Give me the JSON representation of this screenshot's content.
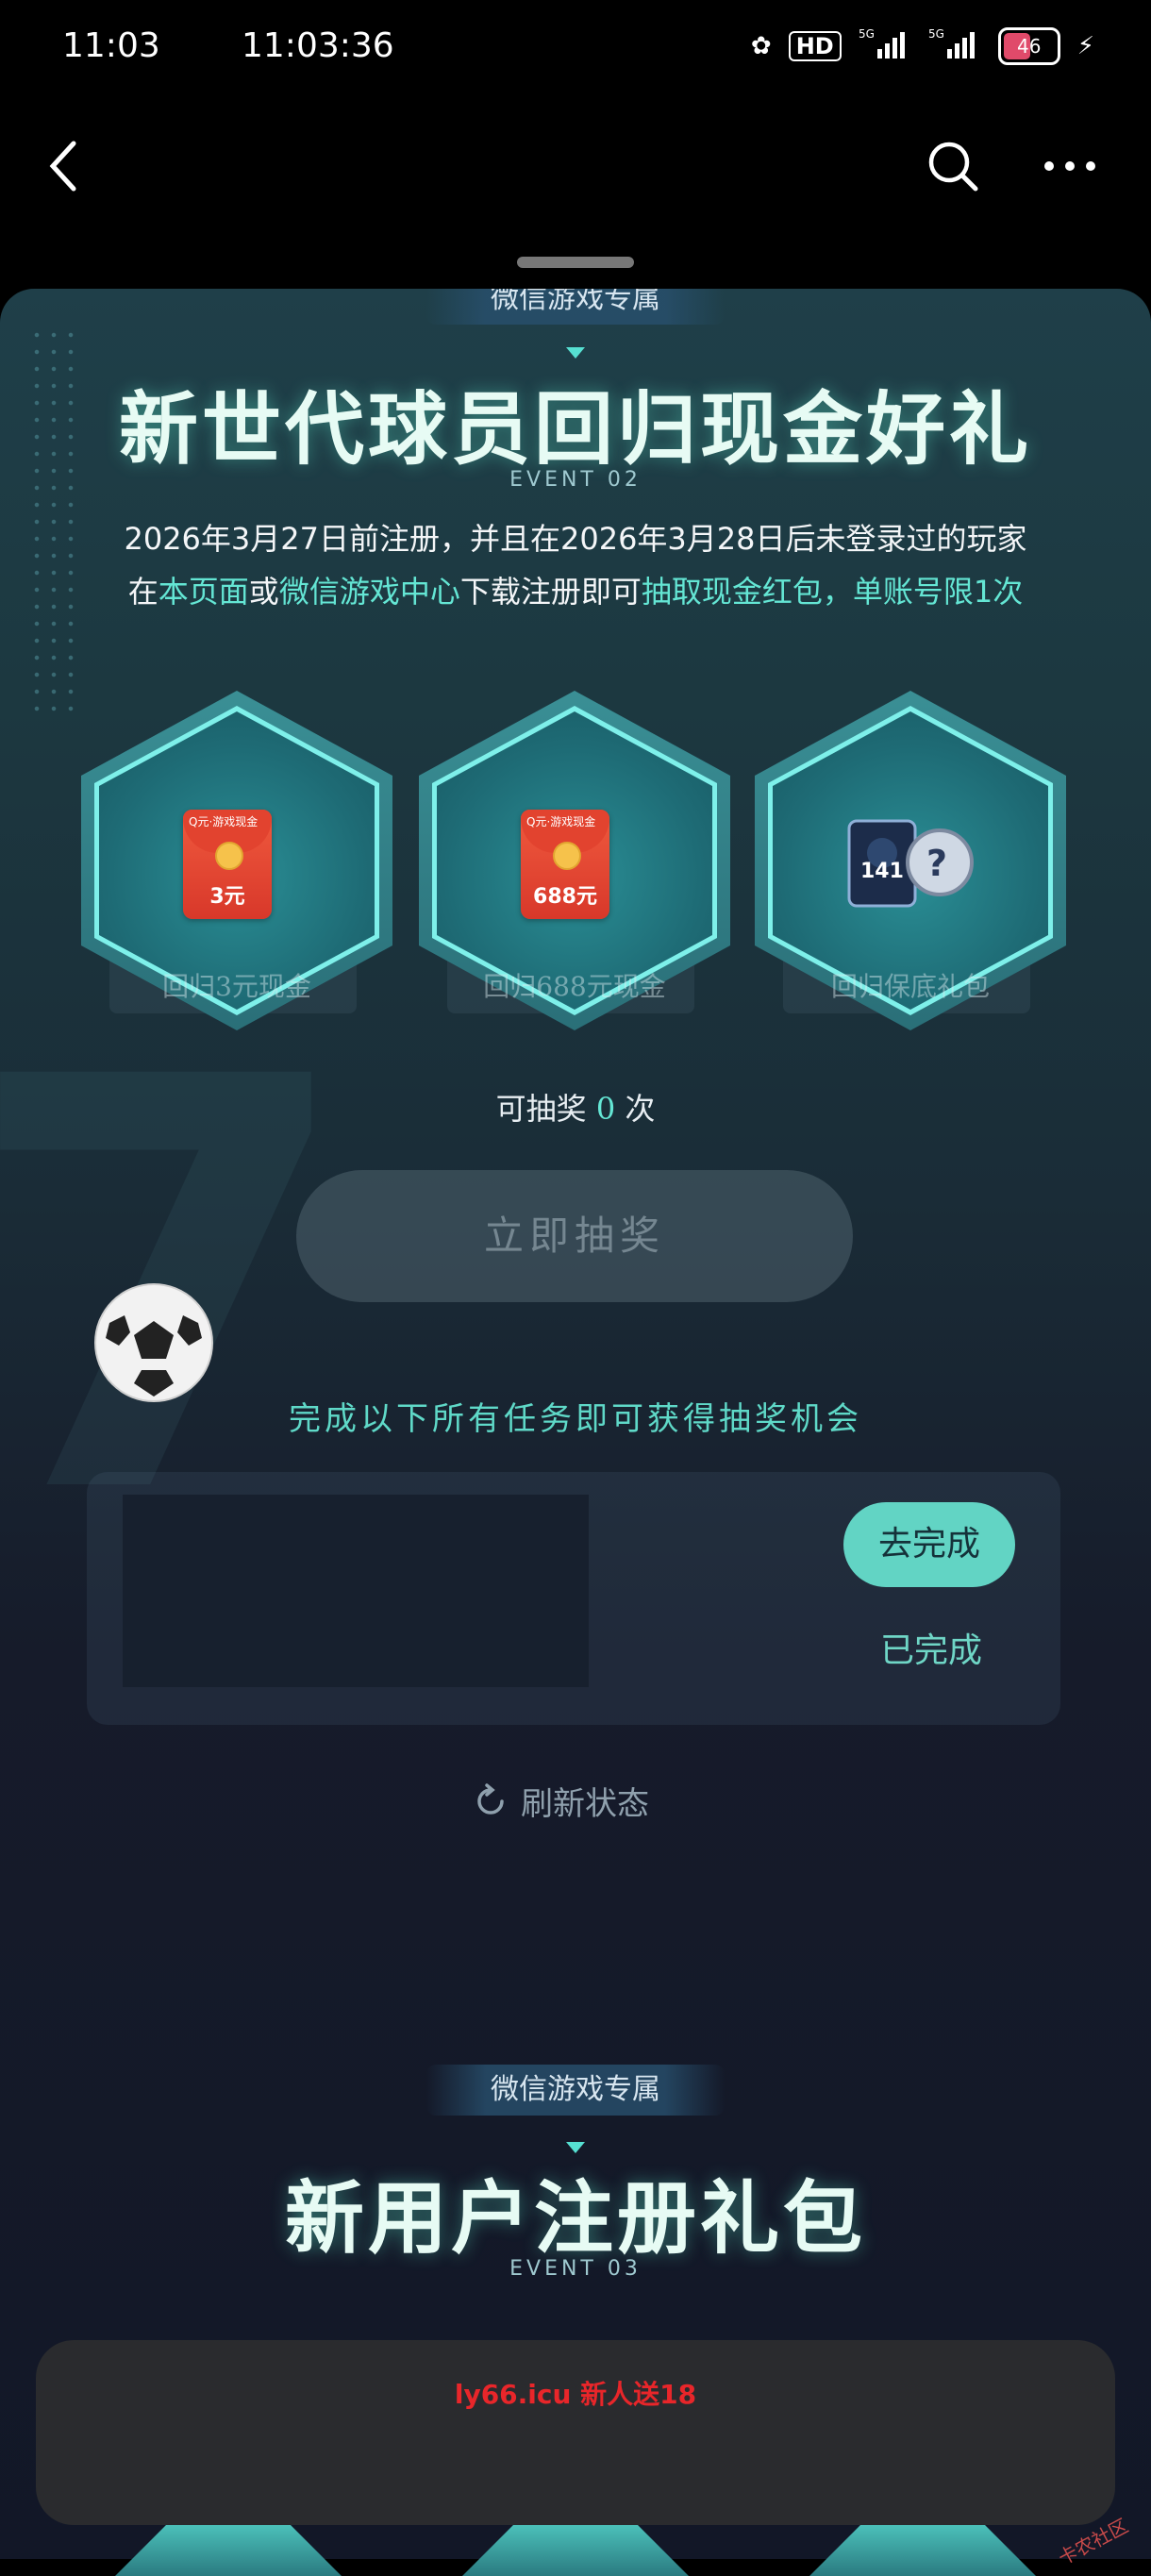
{
  "status_bar": {
    "time_left": "11:03",
    "time_center": "11:03:36",
    "hd_label": "HD",
    "battery_level": "46"
  },
  "section1": {
    "tag": "微信游戏专属",
    "title": "新世代球员回归现金好礼",
    "event_label": "EVENT 02",
    "desc_line1": "2026年3月27日前注册，并且在2026年3月28日后未登录过的玩家",
    "desc_line2_parts": [
      "在",
      "本页面",
      "或",
      "微信游戏中心",
      "下载注册即可",
      "抽取现金红包，单账号限1次"
    ],
    "rewards": [
      {
        "label": "回归3元现金",
        "amount": "3元",
        "icon": "red-envelope-icon"
      },
      {
        "label": "回归688元现金",
        "amount": "688元",
        "icon": "red-envelope-icon"
      },
      {
        "label": "回归保底礼包",
        "card_number": "141",
        "card_mark": "?",
        "icon": "player-cards-icon"
      }
    ],
    "envelope_logo": "Q元·游戏现金",
    "draw_count_prefix": "可抽奖",
    "draw_count": "0",
    "draw_count_suffix": "次",
    "draw_button": "立即抽奖",
    "task_hint": "完成以下所有任务即可获得抽奖机会",
    "go_button": "去完成",
    "done_label": "已完成",
    "refresh_label": "刷新状态"
  },
  "section2": {
    "tag": "微信游戏专属",
    "title": "新用户注册礼包",
    "event_label": "EVENT 03"
  },
  "ad_banner": {
    "text": "ly66.icu 新人送18"
  },
  "colors": {
    "accent": "#62d4c4",
    "highlight_text": "#64e6d4",
    "ad_red": "#e8262a"
  }
}
